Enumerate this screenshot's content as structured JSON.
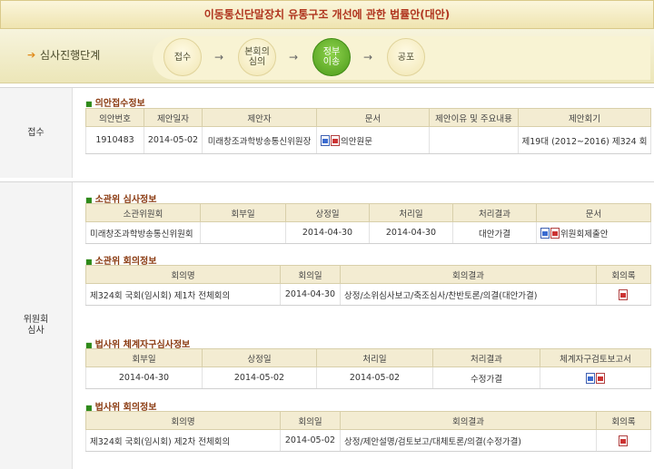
{
  "page_title": "이동통신단말장치 유통구조 개선에 관한 법률안(대안)",
  "stage": {
    "label": "심사진행단계",
    "steps": [
      "접수",
      "본회의\n심의",
      "정부\n이송",
      "공포"
    ],
    "active_index": 2
  },
  "reception": {
    "side_label": "접수",
    "title": "의안접수정보",
    "headers": [
      "의안번호",
      "제안일자",
      "제안자",
      "문서",
      "제안이유 및 주요내용",
      "제안회기"
    ],
    "row": {
      "bill_no": "1910483",
      "date": "2014-05-02",
      "proposer": "미래창조과학방송통신위원장",
      "doc": "의안원문",
      "reason": "",
      "session": "제19대 (2012~2016) 제324 회"
    }
  },
  "committee": {
    "side_label": "위원회\n심사",
    "review_title": "소관위 심사정보",
    "review_headers": [
      "소관위원회",
      "회부일",
      "상정일",
      "처리일",
      "처리결과",
      "문서"
    ],
    "review_row": {
      "committee": "미래창조과학방송통신위원회",
      "referral": "",
      "presented": "2014-04-30",
      "processed": "2014-04-30",
      "result": "대안가결",
      "doc": "위원회제출안"
    },
    "meeting_title": "소관위 회의정보",
    "meeting_headers": [
      "회의명",
      "회의일",
      "회의결과",
      "회의록"
    ],
    "meeting_row": {
      "name": "제324회 국회(임시회) 제1차 전체회의",
      "date": "2014-04-30",
      "result": "상정/소위심사보고/축조심사/찬반토론/의결(대안가결)"
    },
    "legal_title": "법사위 체계자구심사정보",
    "legal_headers": [
      "회부일",
      "상정일",
      "처리일",
      "처리결과",
      "체계자구검토보고서"
    ],
    "legal_row": {
      "referral": "2014-04-30",
      "presented": "2014-05-02",
      "processed": "2014-05-02",
      "result": "수정가결"
    },
    "legal_meeting_title": "법사위 회의정보",
    "legal_meeting_headers": [
      "회의명",
      "회의일",
      "회의결과",
      "회의록"
    ],
    "legal_meeting_row": {
      "name": "제324회 국회(임시회) 제2차 전체회의",
      "date": "2014-05-02",
      "result": "상정/제안설명/검토보고/대체토론/의결(수정가결)"
    }
  }
}
